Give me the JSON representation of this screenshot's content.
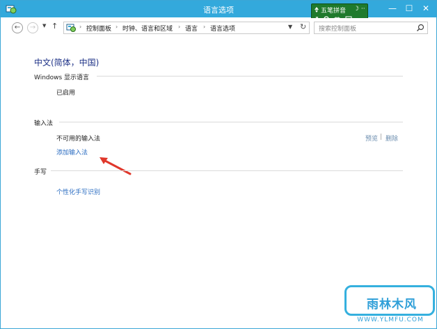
{
  "window": {
    "title": "语言选项",
    "min_glyph": "—",
    "max_glyph": "☐",
    "close_glyph": "✕"
  },
  "ime": {
    "name": "五笔拼音",
    "mode": "英",
    "sym": "☽ ‧‧"
  },
  "nav": {
    "back_glyph": "←",
    "forward_glyph": "→",
    "dropdown_glyph": "▼",
    "up_glyph": "↑",
    "breadcrumbs": [
      "控制面板",
      "时钟、语言和区域",
      "语言",
      "语言选项"
    ],
    "separator": "›",
    "refresh_glyph": "↻",
    "search_placeholder": "搜索控制面板"
  },
  "main": {
    "heading": "中文(简体，中国)",
    "display_language": {
      "title": "Windows 显示语言",
      "status": "已启用"
    },
    "input_method": {
      "title": "输入法",
      "item": "不可用的输入法",
      "preview": "预览",
      "pipe": "|",
      "delete": "删除",
      "add_link": "添加输入法"
    },
    "handwriting": {
      "title": "手写",
      "link": "个性化手写识别"
    }
  },
  "watermark": {
    "text": "雨林木风",
    "url": "WWW.YLMFU.COM"
  },
  "colors": {
    "titlebar": "#33a9dc",
    "heading": "#1e3287",
    "link": "#2a6cc1",
    "arrow": "#e0372b",
    "ime": "#1f7a2c"
  }
}
